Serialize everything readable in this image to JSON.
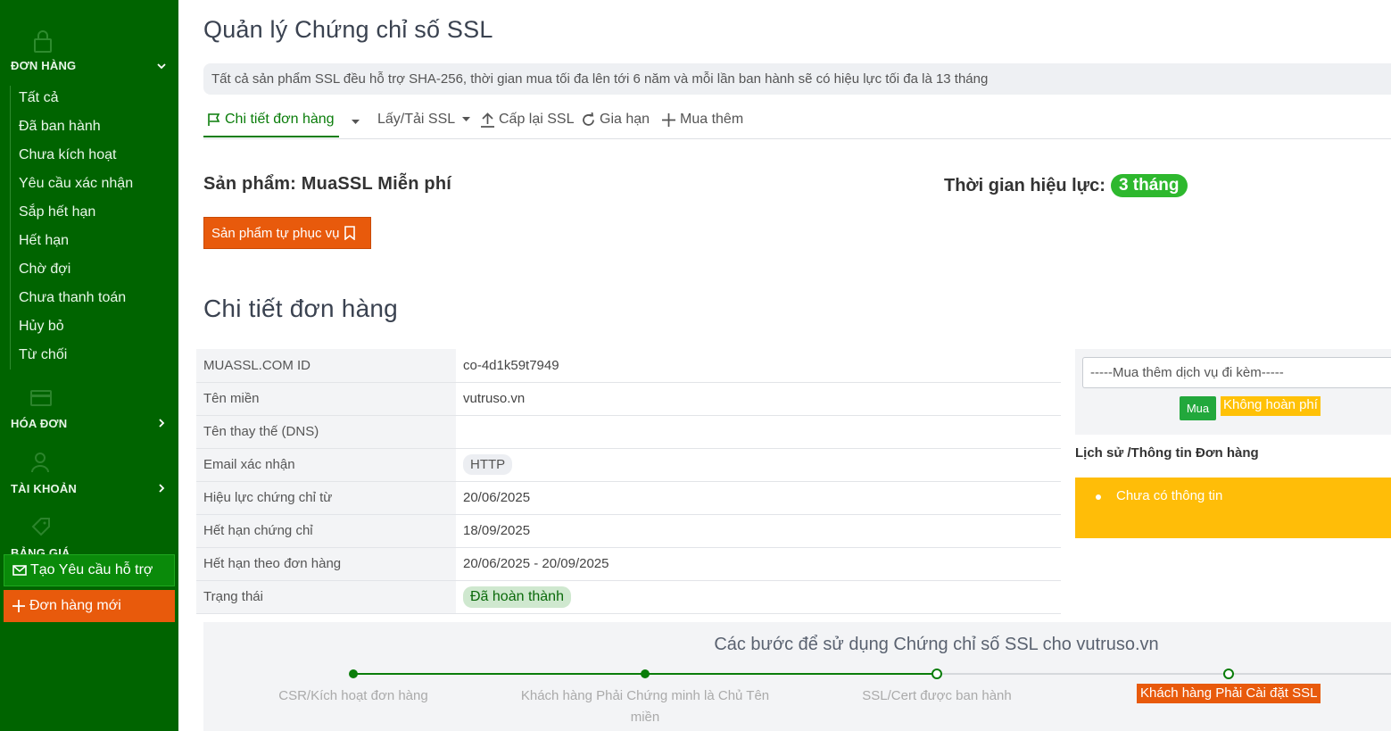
{
  "sidebar": {
    "orders_group": "ĐƠN HÀNG",
    "items": [
      {
        "label": "Tất cả"
      },
      {
        "label": "Đã ban hành"
      },
      {
        "label": "Chưa kích hoạt"
      },
      {
        "label": "Yêu cầu xác nhận"
      },
      {
        "label": "Sắp hết hạn"
      },
      {
        "label": "Hết hạn"
      },
      {
        "label": "Chờ đợi"
      },
      {
        "label": "Chưa thanh toán"
      },
      {
        "label": "Hủy bỏ"
      },
      {
        "label": "Từ chối"
      }
    ],
    "invoice_group": "HÓA ĐƠN",
    "account_group": "TÀI KHOẢN",
    "pricing_group": "BẢNG GIÁ",
    "support_button": "Tạo Yêu cầu hỗ trợ",
    "new_order_button": "Đơn hàng mới"
  },
  "header": {
    "title": "Quản lý Chứng chỉ số SSL",
    "info": "Tất cả sản phẩm SSL đều hỗ trợ SHA-256, thời gian mua tối đa lên tới 6 năm và mỗi lần ban hành sẽ có hiệu lực tối đa là 13 tháng"
  },
  "tabs": [
    {
      "label": "Chi tiết đơn hàng"
    },
    {
      "label": "Lấy/Tải SSL"
    },
    {
      "label": "Cấp lại SSL"
    },
    {
      "label": "Gia hạn"
    },
    {
      "label": "Mua thêm"
    }
  ],
  "product": {
    "label": "Sản phẩm: MuaSSL Miễn phí",
    "validity_label": "Thời gian hiệu lực:",
    "validity_value": "3 tháng",
    "self_service_button": "Sản phẩm tự phục vụ"
  },
  "details": {
    "title": "Chi tiết đơn hàng",
    "rows": [
      {
        "key": "MUASSL.COM ID",
        "value": "co-4d1k59t7949"
      },
      {
        "key": "Tên miền",
        "value": "vutruso.vn"
      },
      {
        "key": "Tên thay thế (DNS)",
        "value": ""
      },
      {
        "key": "Email xác nhận",
        "value": "HTTP"
      },
      {
        "key": "Hiệu lực chứng chỉ từ",
        "value": "20/06/2025"
      },
      {
        "key": "Hết hạn chứng chỉ",
        "value": "18/09/2025"
      },
      {
        "key": "Hết hạn theo đơn hàng",
        "value": "20/06/2025 - 20/09/2025"
      },
      {
        "key": "Trạng thái",
        "value": "Đã hoàn thành"
      }
    ]
  },
  "addon": {
    "select_value": "-----Mua thêm dịch vụ đi kèm-----",
    "buy_button": "Mua",
    "no_refund": "Không hoàn phí"
  },
  "history": {
    "title": "Lịch sử /Thông tin Đơn hàng",
    "items": [
      "Chưa có thông tin"
    ]
  },
  "steps": {
    "title": "Các bước để sử dụng Chứng chỉ số SSL cho vutruso.vn",
    "items": [
      {
        "label": "CSR/Kích hoạt đơn hàng",
        "state": "done"
      },
      {
        "label": "Khách hàng Phải Chứng minh là Chủ Tên miền",
        "state": "done"
      },
      {
        "label": "SSL/Cert được ban hành",
        "state": "pending"
      },
      {
        "label": "Khách hàng Phải Cài đặt SSL",
        "state": "current"
      }
    ]
  },
  "colors": {
    "sidebar": "#006400",
    "accent_green": "#0a7d0a",
    "orange": "#e85a0c",
    "yellow": "#ffbd08"
  }
}
